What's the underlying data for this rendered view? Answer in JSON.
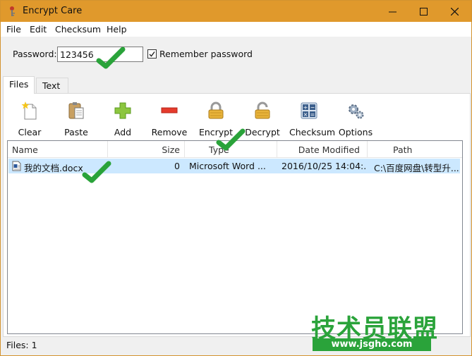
{
  "window": {
    "title": "Encrypt Care"
  },
  "menu": [
    "File",
    "Edit",
    "Checksum",
    "Help"
  ],
  "password": {
    "label": "Password:",
    "value": "123456",
    "remember_label": "Remember password",
    "remember_checked": true
  },
  "tabs": [
    {
      "label": "Files",
      "active": true
    },
    {
      "label": "Text",
      "active": false
    }
  ],
  "toolbar": [
    {
      "label": "Clear",
      "icon": "clear-icon"
    },
    {
      "label": "Paste",
      "icon": "paste-icon"
    },
    {
      "label": "Add",
      "icon": "add-icon"
    },
    {
      "label": "Remove",
      "icon": "remove-icon"
    },
    {
      "label": "Encrypt",
      "icon": "lock-icon"
    },
    {
      "label": "Decrypt",
      "icon": "unlock-icon"
    },
    {
      "label": "Checksum",
      "icon": "calculator-icon"
    },
    {
      "label": "Options",
      "icon": "gears-icon"
    }
  ],
  "file_list": {
    "columns": [
      "Name",
      "Size",
      "Type",
      "Date Modified",
      "Path"
    ],
    "rows": [
      {
        "name": "我的文档.docx",
        "size": "0",
        "type": "Microsoft Word ...",
        "date": "2016/10/25 14:04:...",
        "path": "C:\\百度网盘\\转型升..."
      }
    ]
  },
  "status": {
    "text": "Files: 1"
  },
  "watermark": {
    "text": "技术员联盟",
    "url": "www.jsgho.com"
  },
  "colors": {
    "titlebar": "#e0992c",
    "selection": "#cce8ff",
    "check": "#2aa33a"
  }
}
